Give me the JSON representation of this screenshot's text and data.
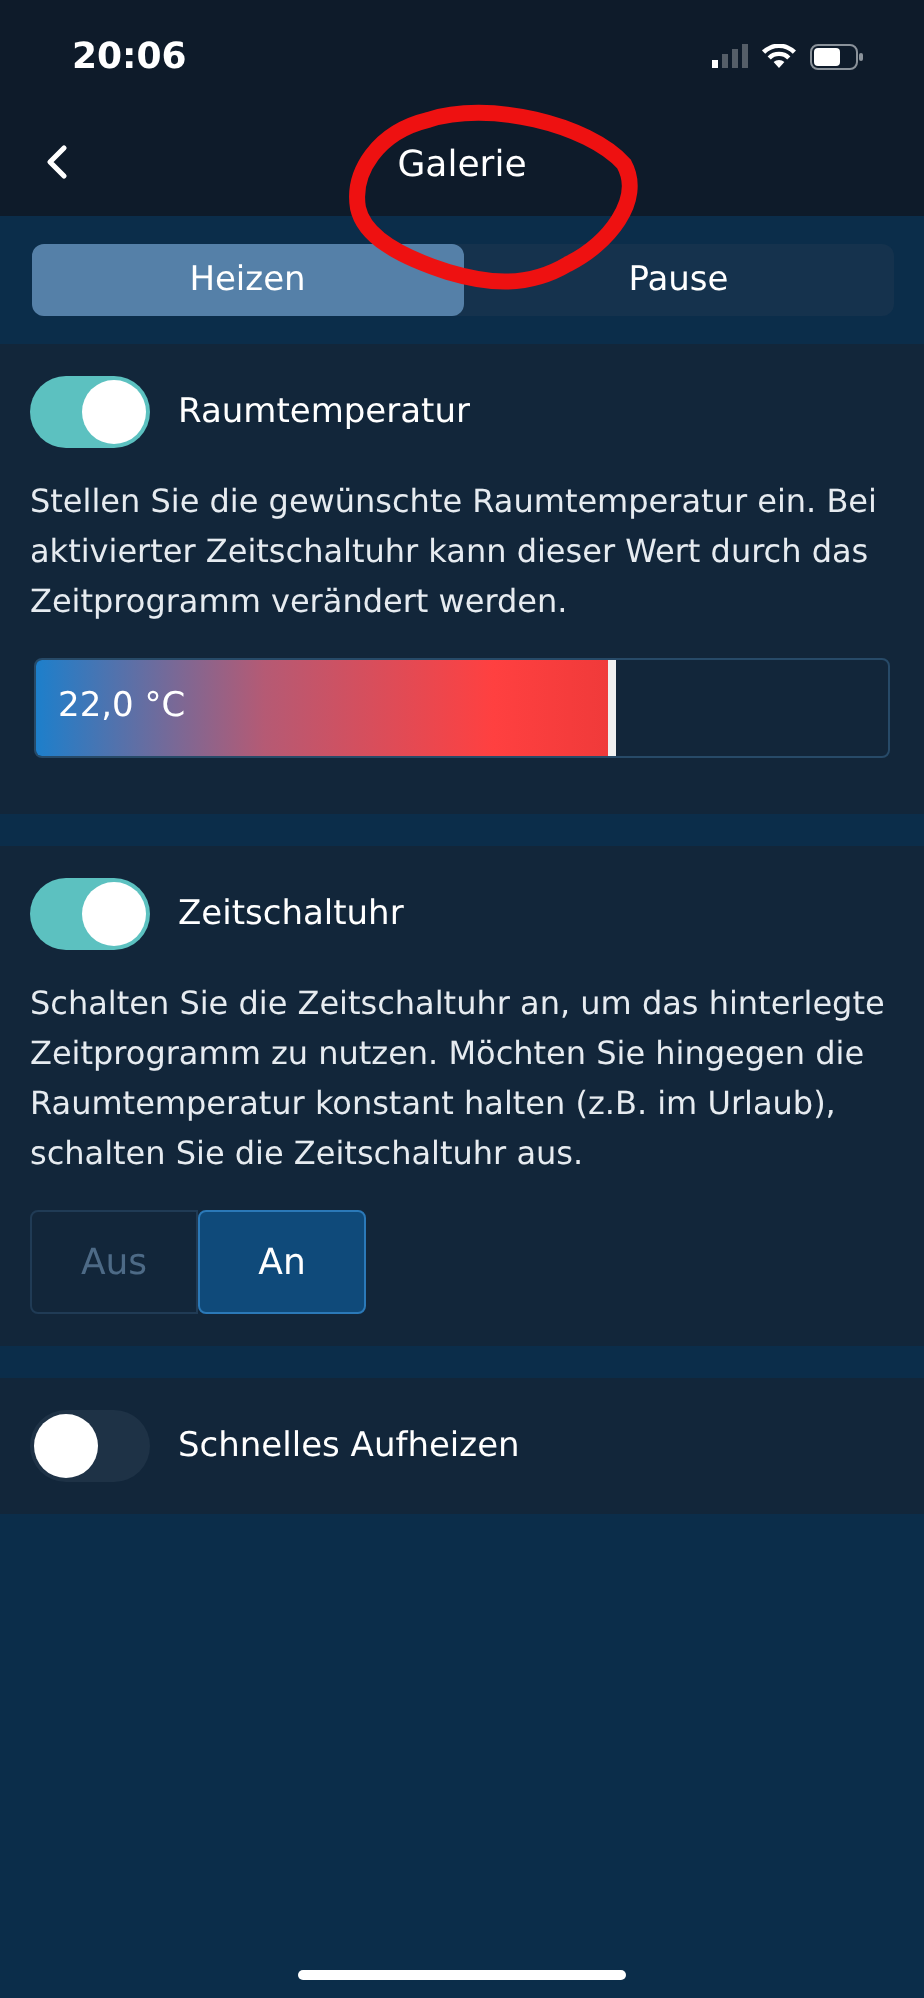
{
  "status_bar": {
    "time": "20:06"
  },
  "header": {
    "title": "Galerie"
  },
  "tabs": [
    {
      "label": "Heizen",
      "selected": true
    },
    {
      "label": "Pause",
      "selected": false
    }
  ],
  "sections": [
    {
      "title": "Raumtemperatur",
      "on": true,
      "description": "Stellen Sie die gewünschte Raumtemperatur ein. Bei aktivierter Zeitschaltuhr kann dieser Wert durch das Zeitprogramm verändert werden.",
      "slider": {
        "reading": "22,0 °C",
        "level": 0.68
      }
    },
    {
      "title": "Zeitschaltuhr",
      "on": true,
      "description": "Schalten Sie die Zeitschaltuhr an, um das hinterlegte Zeitprogramm zu nutzen. Möchten Sie hingegen die Raumtemperatur konstant halten (z.B. im Urlaub), schalten Sie die Zeitschaltuhr aus.",
      "options": [
        {
          "label": "Aus",
          "selected": false
        },
        {
          "label": "An",
          "selected": true
        }
      ]
    },
    {
      "title": "Schnelles Aufheizen",
      "on": false
    }
  ]
}
